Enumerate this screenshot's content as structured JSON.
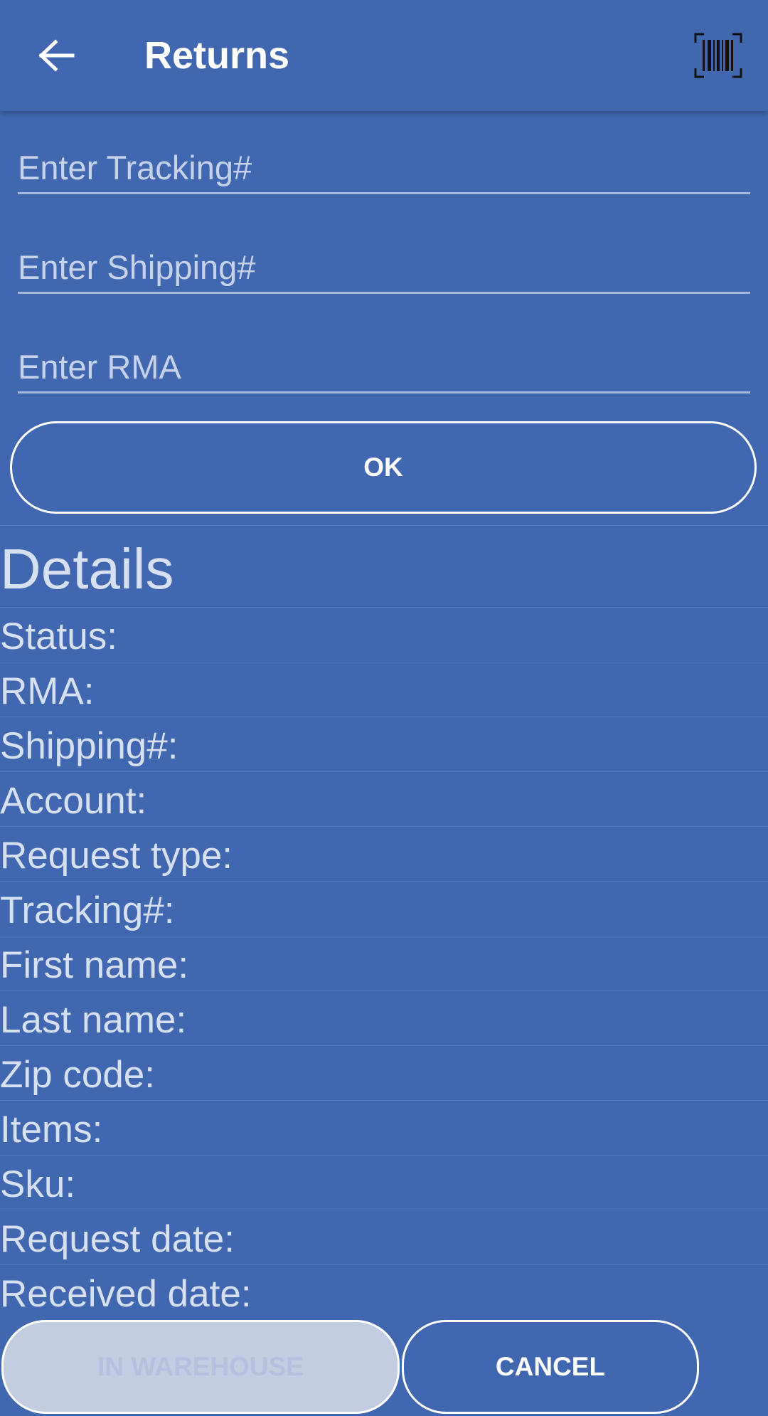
{
  "appbar": {
    "title": "Returns",
    "back_icon": "arrow-back-icon",
    "barcode_icon": "barcode-scan-icon"
  },
  "form": {
    "tracking_placeholder": "Enter Tracking#",
    "shipping_placeholder": "Enter Shipping#",
    "rma_placeholder": "Enter RMA",
    "ok_label": "OK"
  },
  "details": {
    "title": "Details",
    "rows": [
      {
        "label": "Status:"
      },
      {
        "label": "RMA:"
      },
      {
        "label": "Shipping#:"
      },
      {
        "label": "Account:"
      },
      {
        "label": "Request type:"
      },
      {
        "label": "Tracking#:"
      },
      {
        "label": "First name:"
      },
      {
        "label": "Last name:"
      },
      {
        "label": "Zip code:"
      },
      {
        "label": "Items:"
      },
      {
        "label": "Sku:"
      },
      {
        "label": "Request date:"
      },
      {
        "label": "Received date:"
      }
    ]
  },
  "actions": {
    "in_warehouse_label": "IN WAREHOUSE",
    "cancel_label": "CANCEL"
  },
  "colors": {
    "background": "#4167b1",
    "text_light": "#d6e0f1",
    "disabled_button": "#c3cde2"
  }
}
